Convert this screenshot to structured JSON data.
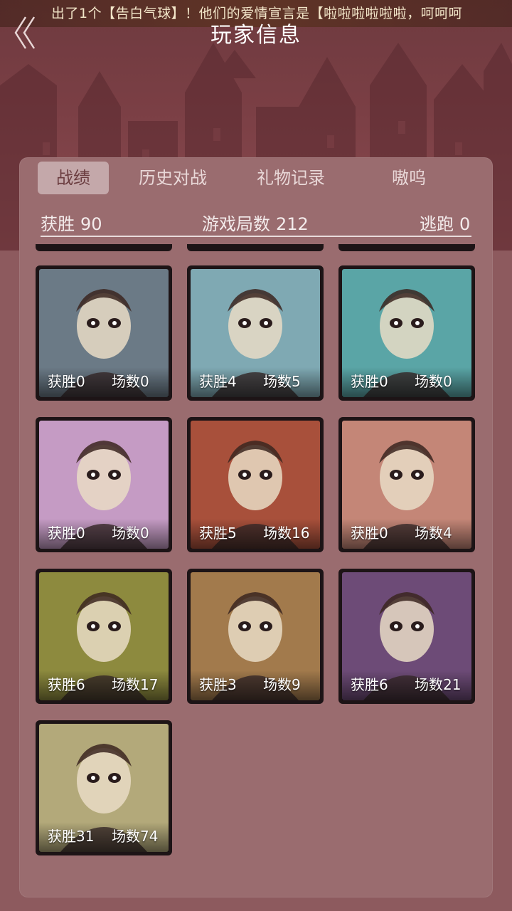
{
  "marquee_text": "出了1个【告白气球】！他们的爱情宣言是【啦啦啦啦啦啦，呵呵呵",
  "header": {
    "title": "玩家信息"
  },
  "tabs": [
    {
      "label": "战绩",
      "active": true
    },
    {
      "label": "历史对战",
      "active": false
    },
    {
      "label": "礼物记录",
      "active": false
    },
    {
      "label": "嗷呜",
      "active": false
    }
  ],
  "stats": {
    "wins_label": "获胜",
    "wins_value": "90",
    "games_label": "游戏局数",
    "games_value": "212",
    "escape_label": "逃跑",
    "escape_value": "0"
  },
  "card_labels": {
    "wins": "获胜",
    "games": "场数"
  },
  "characters": [
    {
      "wins": "0",
      "games": "0",
      "color": "#6b7a86"
    },
    {
      "wins": "4",
      "games": "5",
      "color": "#7fa9b3"
    },
    {
      "wins": "0",
      "games": "0",
      "color": "#5aa5a6"
    },
    {
      "wins": "0",
      "games": "0",
      "color": "#c59bc4"
    },
    {
      "wins": "5",
      "games": "16",
      "color": "#a8503b"
    },
    {
      "wins": "0",
      "games": "4",
      "color": "#c48677"
    },
    {
      "wins": "6",
      "games": "17",
      "color": "#8d8a3e"
    },
    {
      "wins": "3",
      "games": "9",
      "color": "#a27a4c"
    },
    {
      "wins": "6",
      "games": "21",
      "color": "#6d4b77"
    },
    {
      "wins": "31",
      "games": "74",
      "color": "#b3a97a"
    }
  ],
  "colors": {
    "accent": "#c4a8aa",
    "panel": "#9a6c6f",
    "background": "#8d5a5e"
  }
}
